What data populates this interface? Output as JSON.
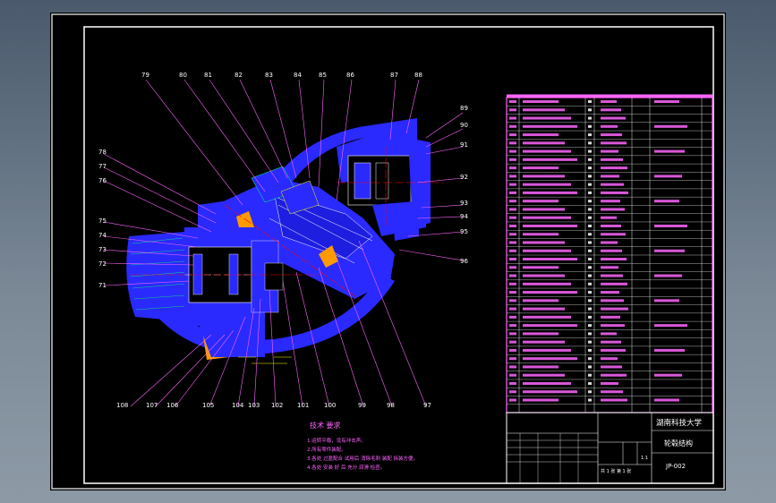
{
  "drawing": {
    "part_numbers_top": [
      "79",
      "80",
      "81",
      "82",
      "83",
      "84",
      "85",
      "86",
      "87",
      "88"
    ],
    "part_numbers_right": [
      "89",
      "90",
      "91",
      "92",
      "93",
      "94",
      "95",
      "96"
    ],
    "part_numbers_left": [
      "78",
      "77",
      "76",
      "75",
      "74",
      "73",
      "72",
      "71"
    ],
    "part_numbers_bottom": [
      "108",
      "107",
      "106",
      "105",
      "104",
      "103",
      "102",
      "101",
      "100",
      "99",
      "98",
      "97"
    ]
  },
  "tech_requirements": {
    "title": "技术  要求",
    "lines": [
      "1.运转平稳，没有冲击声。",
      "2.所有零件装配。",
      "3.各处 过盈配合 试用后 消除毛刺 装配 拆装方便。",
      "4.各处 安装 好 后 充分 润滑 检查。"
    ]
  },
  "title_block": {
    "school": "湖南科技大学",
    "drawing_name": "轮毂结构",
    "drawing_no": "JP-002",
    "scale": "1:1",
    "sheet": "共 1 张  第 1 张"
  },
  "colors": {
    "part_fill": "#2a2aff",
    "line_white": "#ffffff",
    "leader_magenta": "#ff66ff",
    "background": "#000000"
  }
}
